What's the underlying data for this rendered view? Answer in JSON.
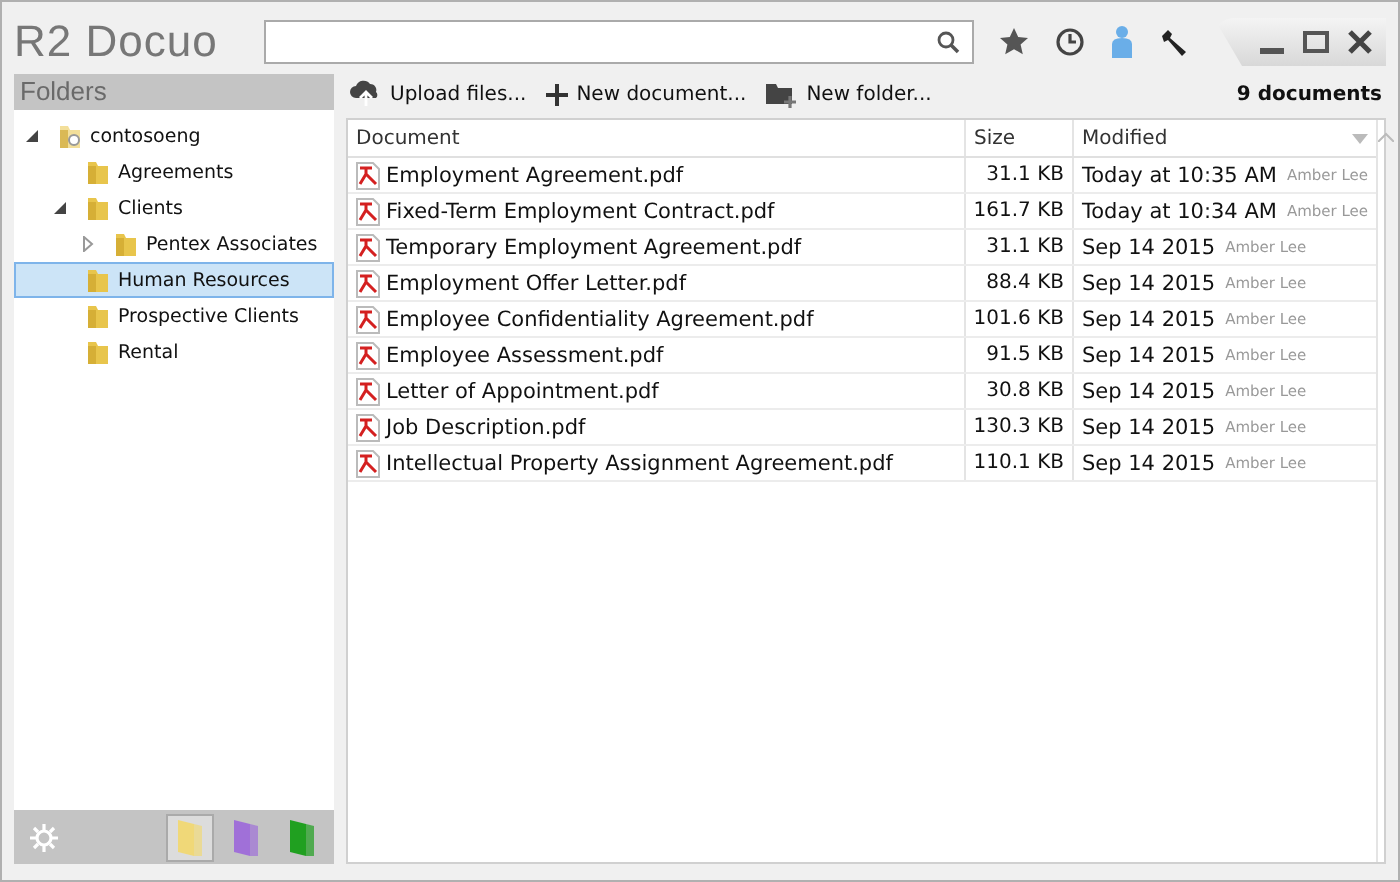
{
  "app": {
    "logo": "R2 Docuo"
  },
  "sidebar": {
    "title": "Folders",
    "tree": [
      {
        "label": "contosoeng",
        "kind": "user",
        "expanded": true,
        "selected": false,
        "children": [
          {
            "label": "Agreements",
            "selected": false
          },
          {
            "label": "Clients",
            "expanded": true,
            "selected": false,
            "children": [
              {
                "label": "Pentex Associates",
                "expanded": false,
                "selected": false
              }
            ]
          },
          {
            "label": "Human Resources",
            "selected": true
          },
          {
            "label": "Prospective Clients",
            "selected": false
          },
          {
            "label": "Rental",
            "selected": false
          }
        ]
      }
    ],
    "views": [
      {
        "color": "#f0d878",
        "selected": true
      },
      {
        "color": "#a070d8",
        "selected": false
      },
      {
        "color": "#20a020",
        "selected": false
      }
    ]
  },
  "toolbar": {
    "actions": [
      {
        "label": "Upload files...",
        "kind": "upload"
      },
      {
        "label": "New document...",
        "kind": "new-document"
      },
      {
        "label": "New folder...",
        "kind": "new-folder"
      }
    ],
    "count": "9 documents"
  },
  "table": {
    "columns": [
      "Document",
      "Size",
      "Modified"
    ],
    "rows": [
      {
        "name": "Employment  Agreement.pdf",
        "size": "31.1 KB",
        "modified": "Today at 10:35 AM",
        "author": "Amber Lee"
      },
      {
        "name": "Fixed-Term Employment Contract.pdf",
        "size": "161.7 KB",
        "modified": "Today at 10:34 AM",
        "author": "Amber Lee"
      },
      {
        "name": "Temporary Employment Agreement.pdf",
        "size": "31.1 KB",
        "modified": "Sep 14 2015",
        "author": "Amber Lee"
      },
      {
        "name": "Employment Offer Letter.pdf",
        "size": "88.4 KB",
        "modified": "Sep 14 2015",
        "author": "Amber Lee"
      },
      {
        "name": "Employee Confidentiality Agreement.pdf",
        "size": "101.6 KB",
        "modified": "Sep 14 2015",
        "author": "Amber Lee"
      },
      {
        "name": "Employee Assessment.pdf",
        "size": "91.5 KB",
        "modified": "Sep 14 2015",
        "author": "Amber Lee"
      },
      {
        "name": "Letter of Appointment.pdf",
        "size": "30.8 KB",
        "modified": "Sep 14 2015",
        "author": "Amber Lee"
      },
      {
        "name": "Job Description.pdf",
        "size": "130.3 KB",
        "modified": "Sep 14 2015",
        "author": "Amber Lee"
      },
      {
        "name": "Intellectual Property Assignment Agreement.pdf",
        "size": "110.1 KB",
        "modified": "Sep 14 2015",
        "author": "Amber Lee"
      }
    ]
  }
}
